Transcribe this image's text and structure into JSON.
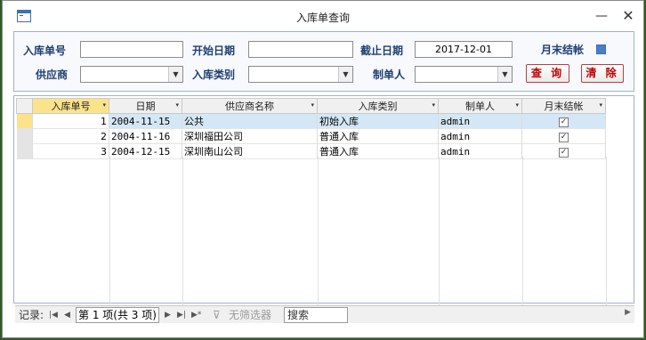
{
  "window": {
    "title": "入库单查询",
    "minimize_glyph": "—",
    "close_glyph": "✕"
  },
  "filters": {
    "receipt_no": {
      "label": "入库单号",
      "value": ""
    },
    "start_date": {
      "label": "开始日期",
      "value": ""
    },
    "end_date": {
      "label": "截止日期",
      "value": "2017-12-01"
    },
    "month_close": {
      "label": "月末结帐",
      "checked": true
    },
    "supplier": {
      "label": "供应商",
      "value": ""
    },
    "receipt_type": {
      "label": "入库类别",
      "value": ""
    },
    "creator": {
      "label": "制单人",
      "value": ""
    },
    "query_button": "查 询",
    "clear_button": "清 除"
  },
  "grid": {
    "columns": [
      "入库单号",
      "日期",
      "供应商名称",
      "入库类别",
      "制单人",
      "月末结帐"
    ],
    "rows": [
      {
        "no": "1",
        "date": "2004-11-15",
        "supplier": "公共",
        "type": "初始入库",
        "creator": "admin",
        "closed": true
      },
      {
        "no": "2",
        "date": "2004-11-16",
        "supplier": "深圳福田公司",
        "type": "普通入库",
        "creator": "admin",
        "closed": true
      },
      {
        "no": "3",
        "date": "2004-12-15",
        "supplier": "深圳南山公司",
        "type": "普通入库",
        "creator": "admin",
        "closed": true
      }
    ],
    "check_glyph": "✓",
    "dropdown_glyph": "▾"
  },
  "navigator": {
    "label": "记录:",
    "first": "|◀",
    "prev": "◀",
    "position": "第 1 项(共 3 项)",
    "next": "▶",
    "last": "▶|",
    "new": "▶*",
    "filter": "无筛选器",
    "search": "搜索"
  },
  "colors": {
    "label_blue": "#1f3f73",
    "button_red": "#c00000",
    "selected_row": "#d4e7f7",
    "active_header": "#fbe38c"
  }
}
